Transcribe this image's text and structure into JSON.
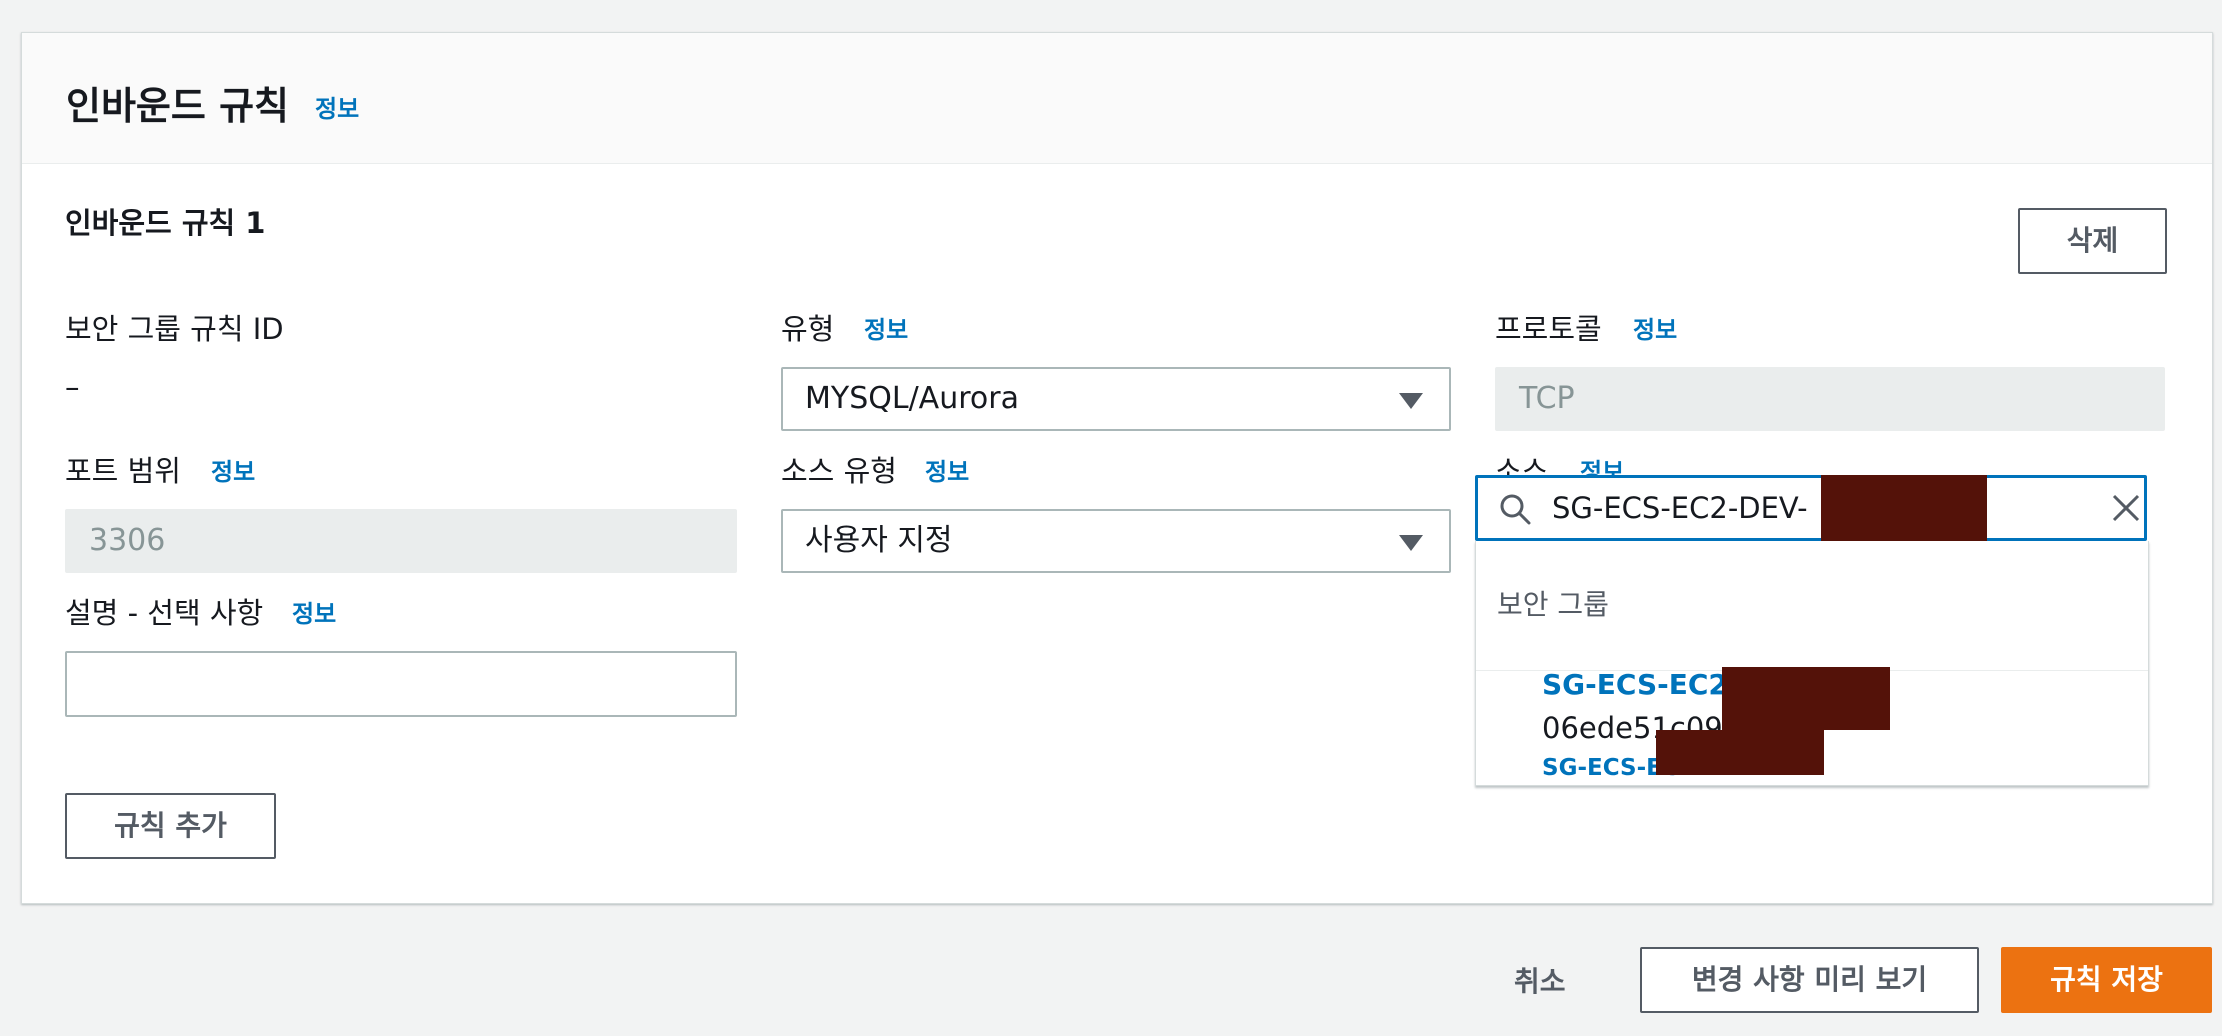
{
  "section": {
    "title": "인바운드 규칙",
    "info_label": "정보"
  },
  "rule": {
    "heading": "인바운드 규칙 1",
    "delete_label": "삭제",
    "rule_id": {
      "label": "보안 그룹 규칙 ID",
      "value": "–"
    },
    "type": {
      "label": "유형",
      "info": "정보",
      "value": "MYSQL/Aurora"
    },
    "protocol": {
      "label": "프로토콜",
      "info": "정보",
      "value": "TCP"
    },
    "port_range": {
      "label": "포트 범위",
      "info": "정보",
      "value": "3306"
    },
    "source_type": {
      "label": "소스 유형",
      "info": "정보",
      "value": "사용자 지정"
    },
    "source": {
      "label": "소스",
      "info": "정보",
      "search_value": "SG-ECS-EC2-DEV-",
      "dropdown": {
        "group_header": "보안 그룹",
        "option": {
          "name": "SG-ECS-EC2-DEV-",
          "id": "06ede51c09f0",
          "tag": "SG-ECS-EC2-DE"
        }
      }
    },
    "description": {
      "label": "설명 - 선택 사항",
      "info": "정보",
      "value": ""
    }
  },
  "add_rule_label": "규칙 추가",
  "footer": {
    "cancel_label": "취소",
    "preview_label": "변경 사항 미리 보기",
    "save_label": "규칙 저장"
  },
  "colors": {
    "link": "#0073bb",
    "primary": "#ec7211",
    "redaction": "#541209",
    "focus_border": "#0073bb"
  },
  "icons": [
    "search-icon",
    "clear-icon",
    "caret-down-icon"
  ]
}
